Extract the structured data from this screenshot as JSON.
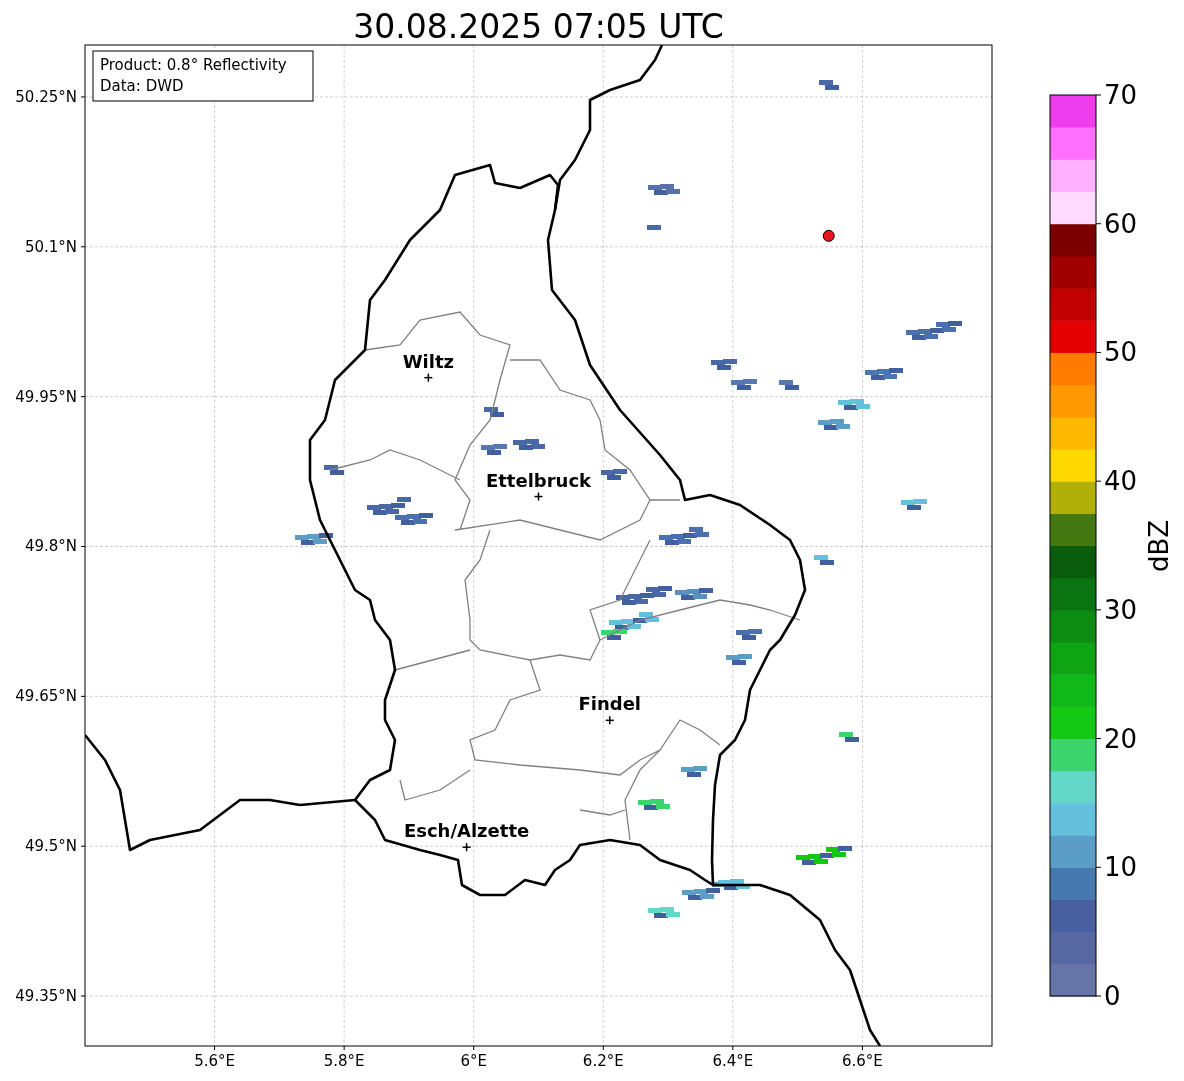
{
  "title": "30.08.2025 07:05 UTC",
  "map": {
    "info_lines": [
      "Product: 0.8° Reflectivity",
      "Data: DWD"
    ],
    "ytick_labels": [
      "50.25°N",
      "50.1°N",
      "49.95°N",
      "49.8°N",
      "49.65°N",
      "49.5°N",
      "49.35°N"
    ],
    "places": [
      "Wiltz",
      "Ettelbruck",
      "Findel",
      "Esch/Alzette"
    ],
    "xtick_labels": [
      "5.6°E",
      "5.8°E",
      "6°E",
      "6.2°E",
      "6.4°E",
      "6.6°E"
    ]
  },
  "colorbar": {
    "tick_labels": [
      "70",
      "60",
      "50",
      "40",
      "30",
      "20",
      "10",
      "0"
    ],
    "label": "dBZ"
  }
}
